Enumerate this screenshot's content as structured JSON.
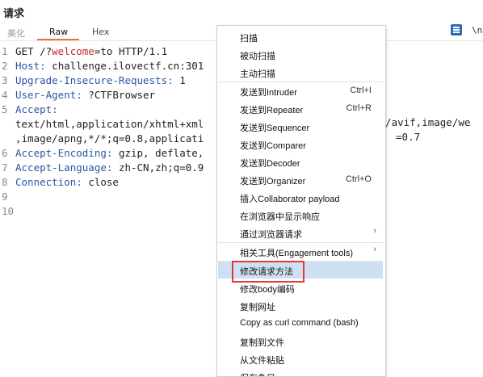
{
  "title": "请求",
  "tabs": [
    {
      "label": "美化"
    },
    {
      "label": "Raw"
    },
    {
      "label": "Hex"
    }
  ],
  "toolbar": {
    "wrap_icon": "wrap-lines-icon",
    "newline_label": "\\n"
  },
  "request_lines": [
    {
      "num": "1",
      "parts": [
        [
          "plain",
          "GET /?"
        ],
        [
          "param",
          "welcome"
        ],
        [
          "plain",
          "=to HTTP/1.1"
        ]
      ]
    },
    {
      "num": "2",
      "parts": [
        [
          "hdr",
          "Host:"
        ],
        [
          "plain",
          " challenge.ilovectf.cn:301"
        ]
      ]
    },
    {
      "num": "3",
      "parts": [
        [
          "hdr",
          "Upgrade-Insecure-Requests:"
        ],
        [
          "plain",
          " 1"
        ]
      ]
    },
    {
      "num": "4",
      "parts": [
        [
          "hdr",
          "User-Agent:"
        ],
        [
          "plain",
          " ?CTFBrowser"
        ]
      ]
    },
    {
      "num": "5",
      "parts": [
        [
          "hdr",
          "Accept:"
        ]
      ]
    },
    {
      "num": "",
      "parts": [
        [
          "plain",
          "text/html,application/xhtml+xml"
        ]
      ]
    },
    {
      "num": "",
      "parts": [
        [
          "plain",
          ",image/apng,*/*;q=0.8,applicati"
        ]
      ]
    },
    {
      "num": "6",
      "parts": [
        [
          "hdr",
          "Accept-Encoding:"
        ],
        [
          "plain",
          " gzip, deflate,"
        ]
      ]
    },
    {
      "num": "7",
      "parts": [
        [
          "hdr",
          "Accept-Language:"
        ],
        [
          "plain",
          " zh-CN,zh;q=0.9"
        ]
      ]
    },
    {
      "num": "8",
      "parts": [
        [
          "hdr",
          "Connection:"
        ],
        [
          "plain",
          " close"
        ]
      ]
    },
    {
      "num": "9",
      "parts": []
    },
    {
      "num": "10",
      "parts": []
    }
  ],
  "overflow_fragments": {
    "line5b": "ge/avif,image/we",
    "line5c": "=0.7"
  },
  "context_menu": {
    "items": [
      {
        "label": "扫描",
        "shortcut": "",
        "submenu": false,
        "sep_after": false
      },
      {
        "label": "被动扫描",
        "shortcut": "",
        "submenu": false,
        "sep_after": false
      },
      {
        "label": "主动扫描",
        "shortcut": "",
        "submenu": false,
        "sep_after": true
      },
      {
        "label": "发送到Intruder",
        "shortcut": "Ctrl+I",
        "submenu": false,
        "sep_after": false
      },
      {
        "label": "发送到Repeater",
        "shortcut": "Ctrl+R",
        "submenu": false,
        "sep_after": false
      },
      {
        "label": "发送到Sequencer",
        "shortcut": "",
        "submenu": false,
        "sep_after": false
      },
      {
        "label": "发送到Comparer",
        "shortcut": "",
        "submenu": false,
        "sep_after": false
      },
      {
        "label": "发送到Decoder",
        "shortcut": "",
        "submenu": false,
        "sep_after": false
      },
      {
        "label": "发送到Organizer",
        "shortcut": "Ctrl+O",
        "submenu": false,
        "sep_after": false
      },
      {
        "label": "插入Collaborator payload",
        "shortcut": "",
        "submenu": false,
        "sep_after": false
      },
      {
        "label": "在浏览器中显示响应",
        "shortcut": "",
        "submenu": false,
        "sep_after": false
      },
      {
        "label": "通过浏览器请求",
        "shortcut": "",
        "submenu": true,
        "sep_after": true
      },
      {
        "label": "相关工具(Engagement tools)",
        "shortcut": "",
        "submenu": true,
        "sep_after": true
      },
      {
        "label": "修改请求方法",
        "shortcut": "",
        "submenu": false,
        "sep_after": false,
        "highlighted": true
      },
      {
        "label": "修改body编码",
        "shortcut": "",
        "submenu": false,
        "sep_after": false
      },
      {
        "label": "复制网址",
        "shortcut": "",
        "submenu": false,
        "sep_after": false
      },
      {
        "label": "Copy as curl command (bash)",
        "shortcut": "",
        "submenu": false,
        "sep_after": false
      },
      {
        "label": "复制到文件",
        "shortcut": "",
        "submenu": false,
        "sep_after": false
      },
      {
        "label": "从文件粘贴",
        "shortcut": "",
        "submenu": false,
        "sep_after": false
      },
      {
        "label": "保存条目",
        "shortcut": "",
        "submenu": false,
        "sep_after": false
      }
    ]
  },
  "colors": {
    "accent_tab": "#e8753a",
    "header_key": "#2b55a3",
    "param": "#c62828",
    "highlight": "#cfe0f3",
    "annotation_box": "#e53935"
  }
}
